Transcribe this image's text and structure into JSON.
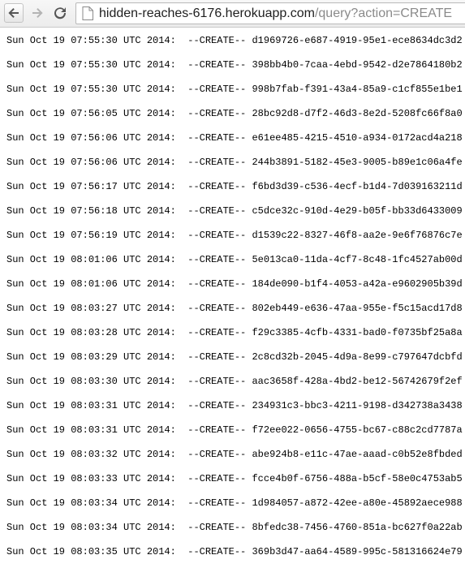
{
  "browser": {
    "url_host": "hidden-reaches-6176.herokuapp.com",
    "url_path": "/query?action=CREATE",
    "icons": {
      "back": "back-arrow-icon",
      "forward": "forward-arrow-icon",
      "reload": "reload-icon",
      "page": "page-icon"
    }
  },
  "log": {
    "lines": [
      {
        "timestamp": "Sun Oct 19 07:55:30 UTC 2014:",
        "action": "--CREATE--",
        "id": "d1969726-e687-4919-95e1-ece8634dc3d2"
      },
      {
        "timestamp": "Sun Oct 19 07:55:30 UTC 2014:",
        "action": "--CREATE--",
        "id": "398bb4b0-7caa-4ebd-9542-d2e7864180b2"
      },
      {
        "timestamp": "Sun Oct 19 07:55:30 UTC 2014:",
        "action": "--CREATE--",
        "id": "998b7fab-f391-43a4-85a9-c1cf855e1be1"
      },
      {
        "timestamp": "Sun Oct 19 07:56:05 UTC 2014:",
        "action": "--CREATE--",
        "id": "28bc92d8-d7f2-46d3-8e2d-5208fc66f8a0"
      },
      {
        "timestamp": "Sun Oct 19 07:56:06 UTC 2014:",
        "action": "--CREATE--",
        "id": "e61ee485-4215-4510-a934-0172acd4a218"
      },
      {
        "timestamp": "Sun Oct 19 07:56:06 UTC 2014:",
        "action": "--CREATE--",
        "id": "244b3891-5182-45e3-9005-b89e1c06a4fe"
      },
      {
        "timestamp": "Sun Oct 19 07:56:17 UTC 2014:",
        "action": "--CREATE--",
        "id": "f6bd3d39-c536-4ecf-b1d4-7d039163211d"
      },
      {
        "timestamp": "Sun Oct 19 07:56:18 UTC 2014:",
        "action": "--CREATE--",
        "id": "c5dce32c-910d-4e29-b05f-bb33d6433009"
      },
      {
        "timestamp": "Sun Oct 19 07:56:19 UTC 2014:",
        "action": "--CREATE--",
        "id": "d1539c22-8327-46f8-aa2e-9e6f76876c7e"
      },
      {
        "timestamp": "Sun Oct 19 08:01:06 UTC 2014:",
        "action": "--CREATE--",
        "id": "5e013ca0-11da-4cf7-8c48-1fc4527ab00d"
      },
      {
        "timestamp": "Sun Oct 19 08:01:06 UTC 2014:",
        "action": "--CREATE--",
        "id": "184de090-b1f4-4053-a42a-e9602905b39d"
      },
      {
        "timestamp": "Sun Oct 19 08:03:27 UTC 2014:",
        "action": "--CREATE--",
        "id": "802eb449-e636-47aa-955e-f5c15acd17d8"
      },
      {
        "timestamp": "Sun Oct 19 08:03:28 UTC 2014:",
        "action": "--CREATE--",
        "id": "f29c3385-4cfb-4331-bad0-f0735bf25a8a"
      },
      {
        "timestamp": "Sun Oct 19 08:03:29 UTC 2014:",
        "action": "--CREATE--",
        "id": "2c8cd32b-2045-4d9a-8e99-c797647dcbfd"
      },
      {
        "timestamp": "Sun Oct 19 08:03:30 UTC 2014:",
        "action": "--CREATE--",
        "id": "aac3658f-428a-4bd2-be12-56742679f2ef"
      },
      {
        "timestamp": "Sun Oct 19 08:03:31 UTC 2014:",
        "action": "--CREATE--",
        "id": "234931c3-bbc3-4211-9198-d342738a3438"
      },
      {
        "timestamp": "Sun Oct 19 08:03:31 UTC 2014:",
        "action": "--CREATE--",
        "id": "f72ee022-0656-4755-bc67-c88c2cd7787a"
      },
      {
        "timestamp": "Sun Oct 19 08:03:32 UTC 2014:",
        "action": "--CREATE--",
        "id": "abe924b8-e11c-47ae-aaad-c0b52e8fbded"
      },
      {
        "timestamp": "Sun Oct 19 08:03:33 UTC 2014:",
        "action": "--CREATE--",
        "id": "fcce4b0f-6756-488a-b5cf-58e0c4753ab5"
      },
      {
        "timestamp": "Sun Oct 19 08:03:34 UTC 2014:",
        "action": "--CREATE--",
        "id": "1d984057-a872-42ee-a80e-45892aece988"
      },
      {
        "timestamp": "Sun Oct 19 08:03:34 UTC 2014:",
        "action": "--CREATE--",
        "id": "8bfedc38-7456-4760-851a-bc627f0a22ab"
      },
      {
        "timestamp": "Sun Oct 19 08:03:35 UTC 2014:",
        "action": "--CREATE--",
        "id": "369b3d47-aa64-4589-995c-581316624e79"
      }
    ]
  }
}
